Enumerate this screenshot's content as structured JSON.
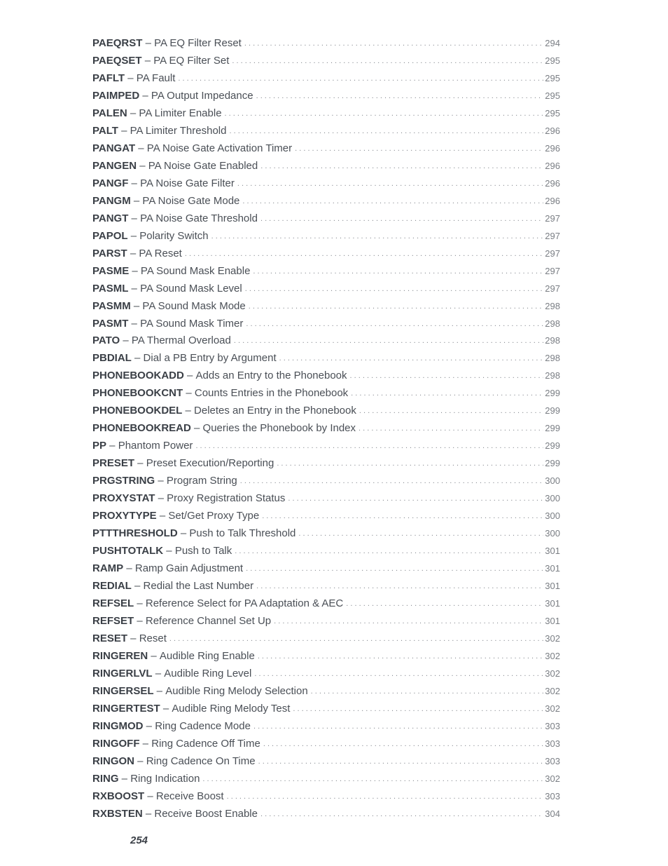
{
  "entries": [
    {
      "cmd": "PAEQRST",
      "desc": "PA EQ Filter Reset",
      "page": "294"
    },
    {
      "cmd": "PAEQSET",
      "desc": "PA EQ Filter Set",
      "page": "295"
    },
    {
      "cmd": "PAFLT",
      "desc": "PA Fault",
      "page": "295"
    },
    {
      "cmd": "PAIMPED",
      "desc": "PA Output Impedance",
      "page": "295"
    },
    {
      "cmd": "PALEN",
      "desc": "PA Limiter Enable",
      "page": "295"
    },
    {
      "cmd": "PALT",
      "desc": "PA Limiter Threshold",
      "page": "296"
    },
    {
      "cmd": "PANGAT",
      "desc": "PA Noise Gate Activation Timer",
      "page": "296"
    },
    {
      "cmd": "PANGEN",
      "desc": "PA Noise Gate Enabled",
      "page": "296"
    },
    {
      "cmd": "PANGF",
      "desc": "PA Noise Gate Filter",
      "page": "296"
    },
    {
      "cmd": "PANGM",
      "desc": "PA Noise Gate Mode",
      "page": "296"
    },
    {
      "cmd": "PANGT",
      "desc": "PA Noise Gate Threshold",
      "page": "297"
    },
    {
      "cmd": "PAPOL",
      "desc": "Polarity Switch",
      "page": "297"
    },
    {
      "cmd": "PARST",
      "desc": "PA Reset",
      "page": "297"
    },
    {
      "cmd": "PASME",
      "desc": "PA Sound Mask Enable",
      "page": "297"
    },
    {
      "cmd": "PASML",
      "desc": "PA Sound Mask Level",
      "page": "297"
    },
    {
      "cmd": "PASMM",
      "desc": "PA Sound Mask Mode",
      "page": "298"
    },
    {
      "cmd": "PASMT",
      "desc": "PA Sound Mask Timer",
      "page": "298"
    },
    {
      "cmd": "PATO",
      "desc": "PA Thermal Overload",
      "page": "298"
    },
    {
      "cmd": "PBDIAL",
      "desc": "Dial a PB Entry by Argument",
      "page": "298"
    },
    {
      "cmd": "PHONEBOOKADD",
      "desc": "Adds an Entry to the Phonebook",
      "page": "298"
    },
    {
      "cmd": "PHONEBOOKCNT",
      "desc": "Counts Entries in the Phonebook",
      "page": "299"
    },
    {
      "cmd": "PHONEBOOKDEL",
      "desc": "Deletes an Entry in the Phonebook",
      "page": "299"
    },
    {
      "cmd": "PHONEBOOKREAD",
      "desc": "Queries the Phonebook by Index",
      "page": "299"
    },
    {
      "cmd": "PP",
      "desc": "Phantom Power",
      "page": "299"
    },
    {
      "cmd": "PRESET",
      "desc": "Preset Execution/Reporting",
      "page": "299"
    },
    {
      "cmd": "PRGSTRING",
      "desc": "Program String",
      "page": "300"
    },
    {
      "cmd": "PROXYSTAT",
      "desc": "Proxy Registration Status",
      "page": "300"
    },
    {
      "cmd": "PROXYTYPE",
      "desc": "Set/Get Proxy Type",
      "page": "300"
    },
    {
      "cmd": "PTTTHRESHOLD",
      "desc": "Push to Talk Threshold",
      "page": "300"
    },
    {
      "cmd": "PUSHTOTALK",
      "desc": "Push to Talk",
      "page": "301"
    },
    {
      "cmd": "RAMP",
      "desc": "Ramp Gain Adjustment",
      "page": "301"
    },
    {
      "cmd": "REDIAL",
      "desc": "Redial the Last Number",
      "page": "301"
    },
    {
      "cmd": "REFSEL",
      "desc": "Reference Select for PA Adaptation & AEC",
      "page": "301"
    },
    {
      "cmd": "REFSET",
      "desc": "Reference Channel Set Up",
      "page": "301"
    },
    {
      "cmd": "RESET",
      "desc": "Reset",
      "page": "302"
    },
    {
      "cmd": "RINGEREN",
      "desc": "Audible Ring Enable",
      "page": "302"
    },
    {
      "cmd": "RINGERLVL",
      "desc": "Audible Ring Level",
      "page": "302"
    },
    {
      "cmd": "RINGERSEL",
      "desc": "Audible Ring Melody Selection",
      "page": "302"
    },
    {
      "cmd": "RINGERTEST",
      "desc": "Audible Ring Melody Test",
      "page": "302"
    },
    {
      "cmd": "RINGMOD",
      "desc": "Ring Cadence Mode",
      "page": "303"
    },
    {
      "cmd": "RINGOFF",
      "desc": "Ring Cadence Off Time",
      "page": "303"
    },
    {
      "cmd": "RINGON",
      "desc": "Ring Cadence On Time",
      "page": "303"
    },
    {
      "cmd": "RING",
      "desc": "Ring Indication",
      "page": "302"
    },
    {
      "cmd": "RXBOOST",
      "desc": "Receive Boost",
      "page": "303"
    },
    {
      "cmd": "RXBSTEN",
      "desc": "Receive Boost Enable",
      "page": "304"
    }
  ],
  "separator": " – ",
  "footer": {
    "page_number": "254"
  }
}
